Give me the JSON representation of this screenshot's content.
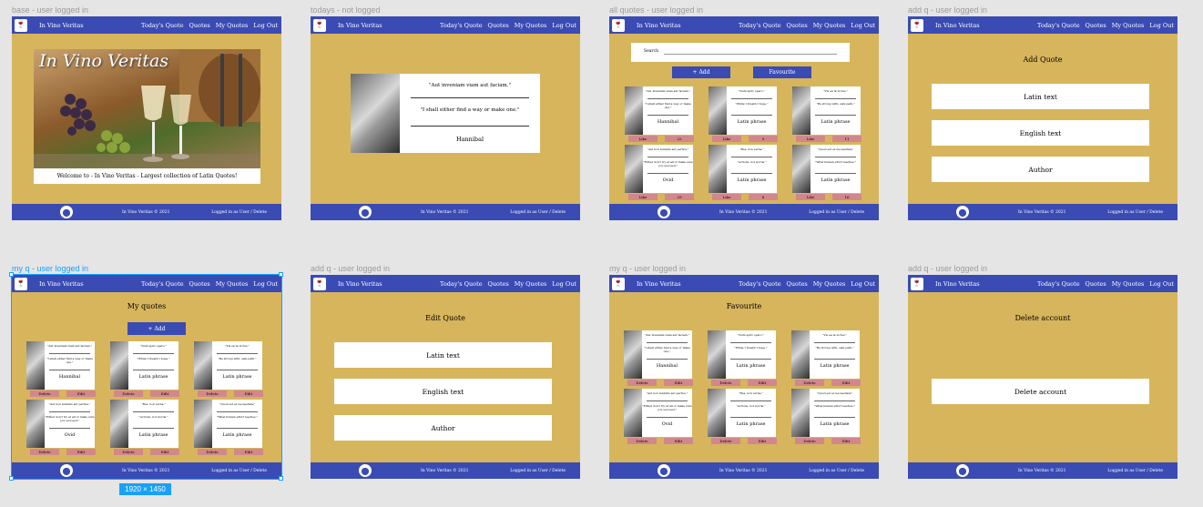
{
  "nav": {
    "brand": "In Vino Veritas",
    "links_logged": [
      "Today's Quote",
      "Quotes",
      "My Quotes",
      "Log Out"
    ]
  },
  "footer": {
    "copyright": "In Vino Veritas © 2021",
    "login": "Logged in as User / Delete"
  },
  "frames": {
    "base": {
      "label": "base - user logged in",
      "hero_title": "In Vino Veritas",
      "welcome": "Welcome to - In Vino Veritas - Largest collection of Latin Quotes!"
    },
    "today": {
      "label": "todays - not logged",
      "latin": "\"Aut inveniam viam aut faciam.\"",
      "english": "\"I shall either find a way or make one.\"",
      "author": "Hannibal"
    },
    "all": {
      "label": "all quotes - user logged in",
      "search": "Search",
      "add": "+ Add",
      "favourite": "Favourite"
    },
    "addq": {
      "label": "add q - user logged in",
      "title": "Add Quote",
      "fields": [
        "Latin text",
        "English text",
        "Author"
      ]
    },
    "myq": {
      "label": "my q - user logged in",
      "title": "My quotes",
      "add": "+ Add"
    },
    "editq": {
      "label": "add q - user logged in",
      "title": "Edit Quote",
      "fields": [
        "Latin text",
        "English text",
        "Author"
      ]
    },
    "fav": {
      "label": "my q - user logged in",
      "title": "Favourite"
    },
    "del": {
      "label": "add q - user logged in",
      "title": "Delete account",
      "button": "Delete account"
    }
  },
  "cards": [
    {
      "latin": "\"Aut inveniam viam aut faciam.\"",
      "english": "\"I shall either find a way or make one.\"",
      "author": "Hannibal",
      "likes": "22"
    },
    {
      "latin": "\"Dum spiro spero.\"",
      "english": "\"While I breath I hope.\"",
      "author": "Latin phrase",
      "likes": "9"
    },
    {
      "latin": "\"Vis ea ta victus.\"",
      "english": "\"Be strong with, safe path.\"",
      "author": "Latin phrase",
      "likes": "11"
    },
    {
      "latin": "\"Aut non tentaris aut perfice.\"",
      "english": "\"Either don't try at all or make sure you succeed.\"",
      "author": "Ovid",
      "likes": "29"
    },
    {
      "latin": "\"Res, non verba.\"",
      "english": "\"Actions, not words.\"",
      "author": "Latin phrase",
      "likes": "8"
    },
    {
      "latin": "\"Quod est ex necessitate\"",
      "english": "\"What human effort teaches.\"",
      "author": "Latin phrase",
      "likes": "16"
    }
  ],
  "card_buttons": {
    "like": "Like",
    "delete": "Delete",
    "edit": "Edit"
  },
  "selection_size": "1920 × 1450"
}
